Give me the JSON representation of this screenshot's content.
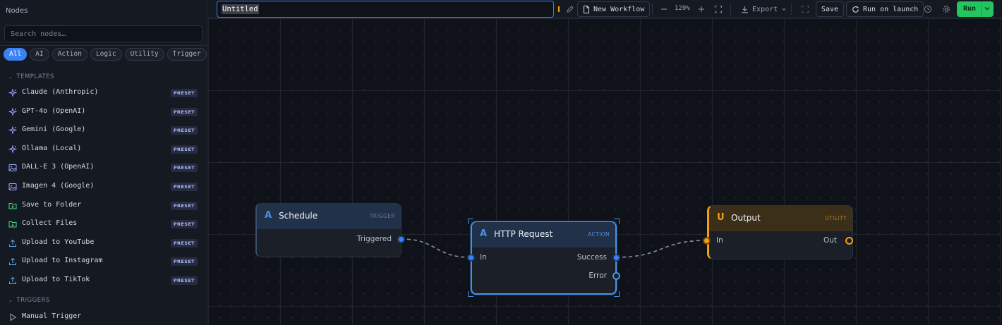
{
  "sidebar": {
    "title": "Nodes",
    "search_placeholder": "Search nodes…",
    "filters": [
      "All",
      "AI",
      "Action",
      "Logic",
      "Utility",
      "Trigger"
    ],
    "active_filter": "All",
    "sections": {
      "templates": "TEMPLATES",
      "triggers": "TRIGGERS"
    },
    "badge_label": "PRESET",
    "templates": [
      {
        "label": "Claude (Anthropic)",
        "icon": "sparkles-icon"
      },
      {
        "label": "GPT-4o (OpenAI)",
        "icon": "sparkles-icon"
      },
      {
        "label": "Gemini (Google)",
        "icon": "sparkles-icon"
      },
      {
        "label": "Ollama (Local)",
        "icon": "sparkles-icon"
      },
      {
        "label": "DALL-E 3 (OpenAI)",
        "icon": "image-icon"
      },
      {
        "label": "Imagen 4 (Google)",
        "icon": "image-icon"
      },
      {
        "label": "Save to Folder",
        "icon": "folder-icon"
      },
      {
        "label": "Collect Files",
        "icon": "folder-icon"
      },
      {
        "label": "Upload to YouTube",
        "icon": "upload-icon"
      },
      {
        "label": "Upload to Instagram",
        "icon": "upload-icon"
      },
      {
        "label": "Upload to TikTok",
        "icon": "upload-icon"
      }
    ],
    "triggers": [
      {
        "label": "Manual Trigger",
        "icon": "play-icon"
      }
    ]
  },
  "toolbar": {
    "workflow_title": "Untitled",
    "new_workflow": "New Workflow",
    "zoom": "120%",
    "export": "Export",
    "save": "Save",
    "run_on_launch": "Run on launch",
    "run": "Run"
  },
  "nodes": {
    "schedule": {
      "icon": "A",
      "title": "Schedule",
      "tag": "TRIGGER",
      "out": "Triggered"
    },
    "http": {
      "icon": "A",
      "title": "HTTP Request",
      "tag": "ACTION",
      "in": "In",
      "out_success": "Success",
      "out_error": "Error"
    },
    "output": {
      "icon": "U",
      "title": "Output",
      "tag": "UTILITY",
      "in": "In",
      "out": "Out"
    }
  },
  "colors": {
    "accent": "#3b82f6",
    "run": "#22c55e",
    "utility": "#f59e0b",
    "preset_badge": "#a9b4ff"
  }
}
